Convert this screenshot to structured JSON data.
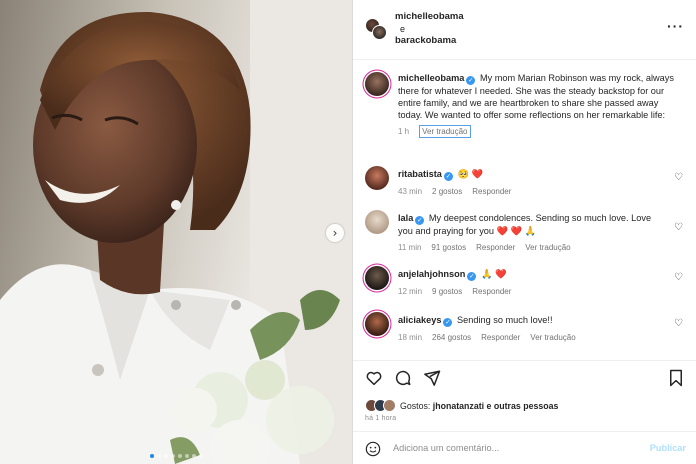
{
  "header": {
    "user1": "michelleobama",
    "joiner": "e",
    "user2": "barackobama",
    "more_icon": "more-horizontal-icon"
  },
  "caption": {
    "username": "michelleobama",
    "text": "My mom Marian Robinson was my rock, always there for whatever I needed. She was the steady backstop for our entire family, and we are heartbroken to share she passed away today. We wanted to offer some reflections on her remarkable life:",
    "time": "1 h",
    "see_translation": "Ver tradução"
  },
  "comments": [
    {
      "username": "ritabatista",
      "text": "🥺 ❤️",
      "time": "43 min",
      "likes": "2 gostos",
      "reply": "Responder"
    },
    {
      "username": "lala",
      "text": "My deepest condolences. Sending so much love. Love you and praying for you ❤️ ❤️ 🙏",
      "time": "11 min",
      "likes": "91 gostos",
      "reply": "Responder",
      "see_translation": "Ver tradução"
    },
    {
      "username": "anjelahjohnson",
      "text": "🙏 ❤️",
      "time": "12 min",
      "likes": "9 gostos",
      "reply": "Responder"
    },
    {
      "username": "aliciakeys",
      "text": "Sending so much love!!",
      "time": "18 min",
      "likes": "264 gostos",
      "reply": "Responder",
      "see_translation": "Ver tradução"
    }
  ],
  "likes": {
    "prefix": "Gostos:",
    "user": "jhonatanzati",
    "suffix": "e outras pessoas"
  },
  "post_time": "há 1 hora",
  "add_comment": {
    "placeholder": "Adiciona um comentário...",
    "post_label": "Publicar"
  },
  "carousel": {
    "slides": 8,
    "active": 0
  },
  "colors": {
    "verified": "#3897f0",
    "link": "#0095f6",
    "post_disabled": "#b2dffc"
  }
}
